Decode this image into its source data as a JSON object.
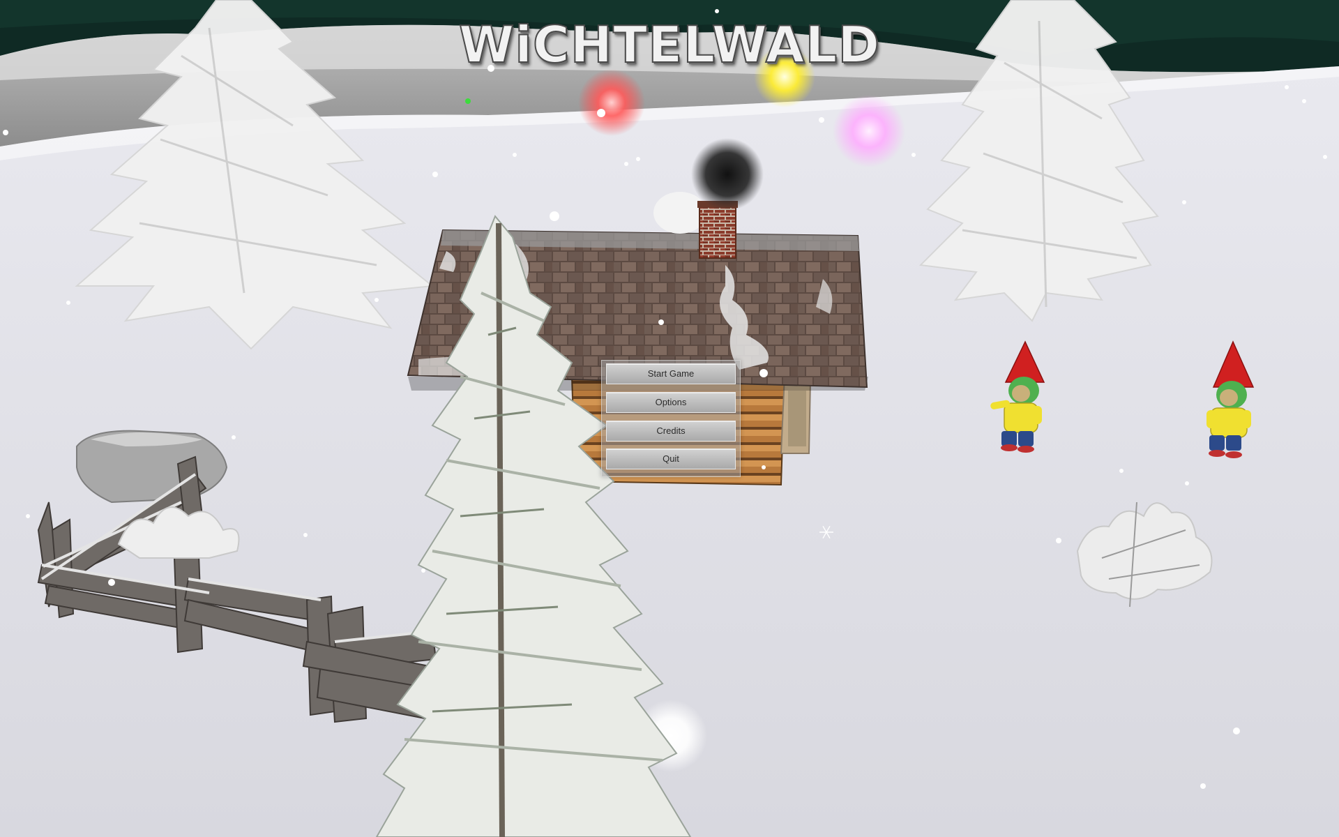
{
  "game": {
    "title": "WiCHTELWALD"
  },
  "main_menu": {
    "items": [
      {
        "label": "Start Game"
      },
      {
        "label": "Options"
      },
      {
        "label": "Credits"
      },
      {
        "label": "Quit"
      }
    ]
  },
  "colors": {
    "sky_night": "#0f2a24",
    "snow": "#e4e4ea",
    "menu_panel": "#a0a0a0",
    "menu_button": "#c4c4c4",
    "gnome_hat": "#d02020",
    "gnome_shirt": "#f0e030",
    "gnome_pants": "#2c4a8a",
    "light_red": "#ff5050",
    "light_yellow": "#ffee33",
    "light_pink": "#ffaaff"
  },
  "icons": {
    "menu_panel": "stone-panel",
    "snowflake": "snowflake-icon"
  }
}
